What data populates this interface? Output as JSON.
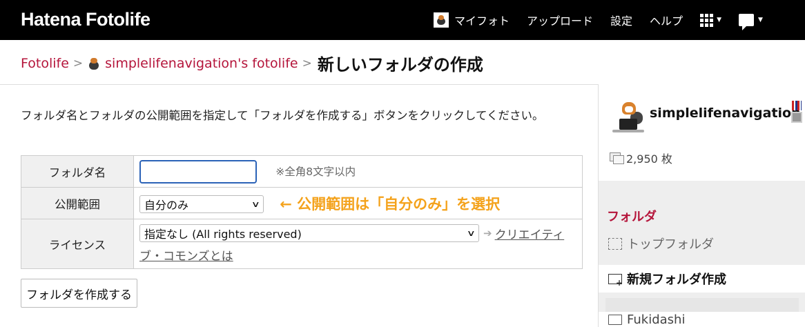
{
  "header": {
    "logo": "Hatena Fotolife",
    "nav": {
      "my_foto": "マイフォト",
      "upload": "アップロード",
      "settings": "設定",
      "help": "ヘルプ"
    }
  },
  "breadcrumb": {
    "root": "Fotolife",
    "separator": ">",
    "user_fotolife": "simplelifenavigation's fotolife",
    "current": "新しいフォルダの作成"
  },
  "main": {
    "intro": "フォルダ名とフォルダの公開範囲を指定して「フォルダを作成する」ボタンをクリックしてください。",
    "form": {
      "folder_name_label": "フォルダ名",
      "folder_name_value": "",
      "folder_name_hint": "※全角8文字以内",
      "visibility_label": "公開範囲",
      "visibility_selected": "自分のみ",
      "visibility_annotation": "← 公開範囲は「自分のみ」を選択",
      "license_label": "ライセンス",
      "license_selected": "指定なし (All rights reserved)",
      "license_link_part1": "クリエイティ",
      "license_link_part2": "ブ・コモンズとは"
    },
    "submit_label": "フォルダを作成する"
  },
  "sidebar": {
    "username": "simplelifenavigation",
    "photo_count": "2,950 枚",
    "folder_section_title": "フォルダ",
    "folders": {
      "top": "トップフォルダ",
      "new": "新規フォルダ作成",
      "fukidashi": "Fukidashi"
    }
  },
  "colors": {
    "accent": "#b5153b",
    "annotation": "#f4a21b",
    "header_bg": "#000000",
    "input_focus": "#2a62b7"
  }
}
